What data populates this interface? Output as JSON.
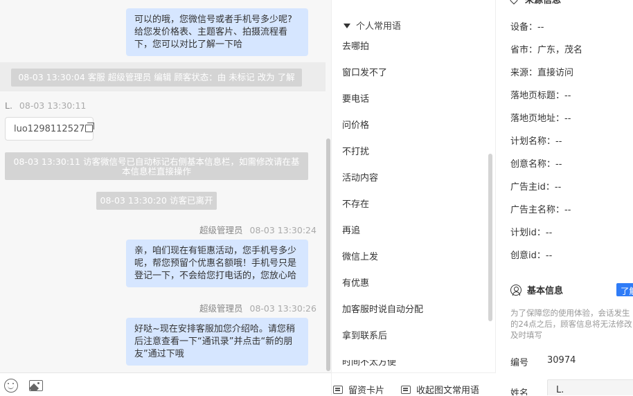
{
  "chat": {
    "messages": [
      {
        "lines": [
          "可以的哦，您微信号或者手机号多少呢?",
          "给您发价格表、主题客片、拍摄流程看",
          "下，您可以对比了解一下哈"
        ]
      },
      {
        "sender": "超级管理员",
        "time": "08-03 13:30:24",
        "lines": [
          "亲，咱们现在有钜惠活动，您手机号多少",
          "呢，帮您预留个优惠名额哦！手机号只是",
          "登记一下，不会给您打电话的，您放心哈"
        ]
      },
      {
        "sender": "超级管理员",
        "time": "08-03 13:30:26",
        "lines": [
          "好哒~现在安排客服加您介绍哈。请您稍",
          "后注意查看一下“通讯录”并点击“新的朋",
          "友”通过下哦"
        ]
      }
    ],
    "system": {
      "status_change": "08-03 13:30:04 客服 超级管理员 编辑 顾客状态：由 未标记 改为 了解",
      "auto_mark": [
        "08-03 13:30:11 访客微信号已自动标记右侧基本信息栏，如需修改请在基",
        "本信息栏直接操作"
      ],
      "left": "08-03 13:30:20 访客已离开"
    },
    "visitor": {
      "name": "L.",
      "time": "08-03 13:30:11",
      "card_text": "luo1298112527"
    }
  },
  "phrases": {
    "group_title": "个人常用语",
    "items": [
      "去哪拍",
      "窗口发不了",
      "要电话",
      "问价格",
      "不打扰",
      "活动内容",
      "不存在",
      "再追",
      "微信上发",
      "有优惠",
      "加客服时说自动分配",
      "拿到联系后"
    ],
    "partial_item": "时间不太方便",
    "buttons": {
      "card": "留资卡片",
      "collapse": "收起图文常用语"
    }
  },
  "info": {
    "source_title": "来源信息",
    "rows": [
      {
        "label": "设备：",
        "value": "--"
      },
      {
        "label": "省市：",
        "value": "广东，茂名"
      },
      {
        "label": "来源：",
        "value": "直接访问"
      },
      {
        "label": "落地页标题：",
        "value": "--"
      },
      {
        "label": "落地页地址：",
        "value": "--"
      },
      {
        "label": "计划名称：",
        "value": "--"
      },
      {
        "label": "创意名称：",
        "value": "--"
      },
      {
        "label": "广告主id：",
        "value": "--"
      },
      {
        "label": "广告主名称：",
        "value": "--"
      },
      {
        "label": "计划id：",
        "value": "--"
      },
      {
        "label": "创意id：",
        "value": "--"
      }
    ],
    "basic_title": "基本信息",
    "learn_label": "了解",
    "note": [
      "为了保障您的使用体验，会话发生",
      "的24点之后，顾客信息将无法修改",
      "及时填写"
    ],
    "number_label": "编号",
    "number_value": "30974",
    "name_label": "姓名",
    "name_value": "L."
  }
}
